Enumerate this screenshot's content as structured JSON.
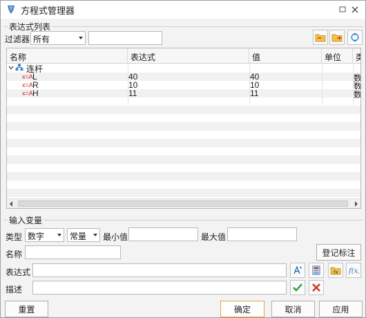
{
  "window": {
    "title": "方程式管理器"
  },
  "expr_list": {
    "group_title": "表达式列表",
    "filter_label": "过滤器",
    "filter_value": "所有",
    "search_value": ""
  },
  "table": {
    "columns": [
      "名称",
      "表达式",
      "值",
      "单位",
      "类"
    ],
    "group": {
      "name": "连杆"
    },
    "rows": [
      {
        "icon": "x=A",
        "name": "L",
        "expr": "40",
        "value": "40",
        "unit": "",
        "type": "数"
      },
      {
        "icon": "x=A",
        "name": "R",
        "expr": "10",
        "value": "10",
        "unit": "",
        "type": "数"
      },
      {
        "icon": "x=A",
        "name": "H",
        "expr": "11",
        "value": "11",
        "unit": "",
        "type": "数"
      }
    ]
  },
  "input": {
    "group_title": "输入变量",
    "type_label": "类型",
    "type_value": "数字",
    "kind_value": "常量",
    "min_label": "最小值",
    "max_label": "最大值",
    "name_label": "名称",
    "register_label": "登记标注",
    "expr_label": "表达式",
    "desc_label": "描述"
  },
  "footer": {
    "reset": "重置",
    "ok": "确定",
    "cancel": "取消",
    "apply": "应用"
  },
  "colors": {
    "accent": "#1e7bd6",
    "ok_border": "#e8a33c",
    "check": "#2a9d3a",
    "cross": "#d23a2a",
    "var_icon": "#cc2222"
  }
}
